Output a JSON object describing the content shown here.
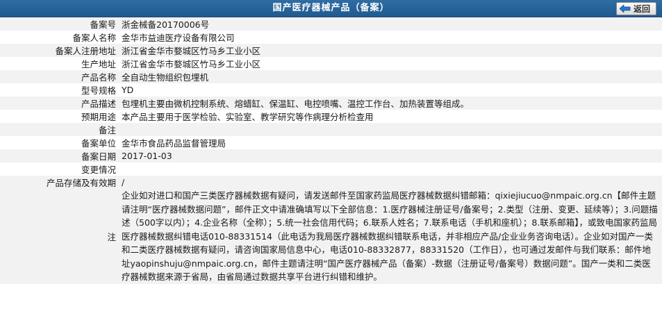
{
  "header": {
    "title": "国产医疗器械产品（备案）",
    "back_label": "返回"
  },
  "rows": [
    {
      "label": "备案号",
      "value": "浙金械备20170006号"
    },
    {
      "label": "备案人名称",
      "value": "金华市益迪医疗设备有限公司"
    },
    {
      "label": "备案人注册地址",
      "value": "浙江省金华市婺城区竹马乡工业小区"
    },
    {
      "label": "生产地址",
      "value": "浙江省金华市婺城区竹马乡工业小区"
    },
    {
      "label": "产品名称",
      "value": "全自动生物组织包埋机"
    },
    {
      "label": "型号规格",
      "value": "YD"
    },
    {
      "label": "产品描述",
      "value": "包埋机主要由微机控制系统、熔蜡缸、保温缸、电控喷嘴、温控工作台、加热装置等组成。"
    },
    {
      "label": "预期用途",
      "value": "本产品主要用于医学检验、实验室、教学研究等作病理分析检查用"
    },
    {
      "label": "备注",
      "value": ""
    },
    {
      "label": "备案单位",
      "value": "金华市食品药品监督管理局"
    },
    {
      "label": "备案日期",
      "value": "2017-01-03"
    },
    {
      "label": "变更情况",
      "value": ""
    },
    {
      "label": "产品存储及有效期",
      "value": "/"
    }
  ],
  "note": {
    "label": "注",
    "text": "企业如对进口和国产三类医疗器械数据有疑问，请发送邮件至国家药监局医疗器械数据纠错邮箱：qixiejiucuo@nmpaic.org.cn【邮件主题请注明“医疗器械数据问题”，邮件正文中请准确填写以下全部信息：1.医疗器械注册证号/备案号；2.类型（注册、变更、延续等）；3.问题描述（500字以内）；4.企业名称（全称）；5.统一社会信用代码；6.联系人姓名；7.联系电话（手机和座机）；8.联系邮箱】，或致电国家药监局医疗器械数据纠错电话010-88331514（此电话为我局医疗器械数据纠错联系电话，并非相应产品/企业业务咨询电话）。企业如对国产一类和二类医疗器械数据有疑问，请咨询国家局信息中心，电话010-88332877，88331520（工作日），也可通过发邮件与我们联系：邮件地址yaopinshuju@nmpaic.org.cn，邮件主题请注明“国产医疗器械产品（备案）-数据（注册证号/备案号）数据问题”。国产一类和二类医疗器械数据来源于省局，由省局通过数据共享平台进行纠错和维护。"
  }
}
